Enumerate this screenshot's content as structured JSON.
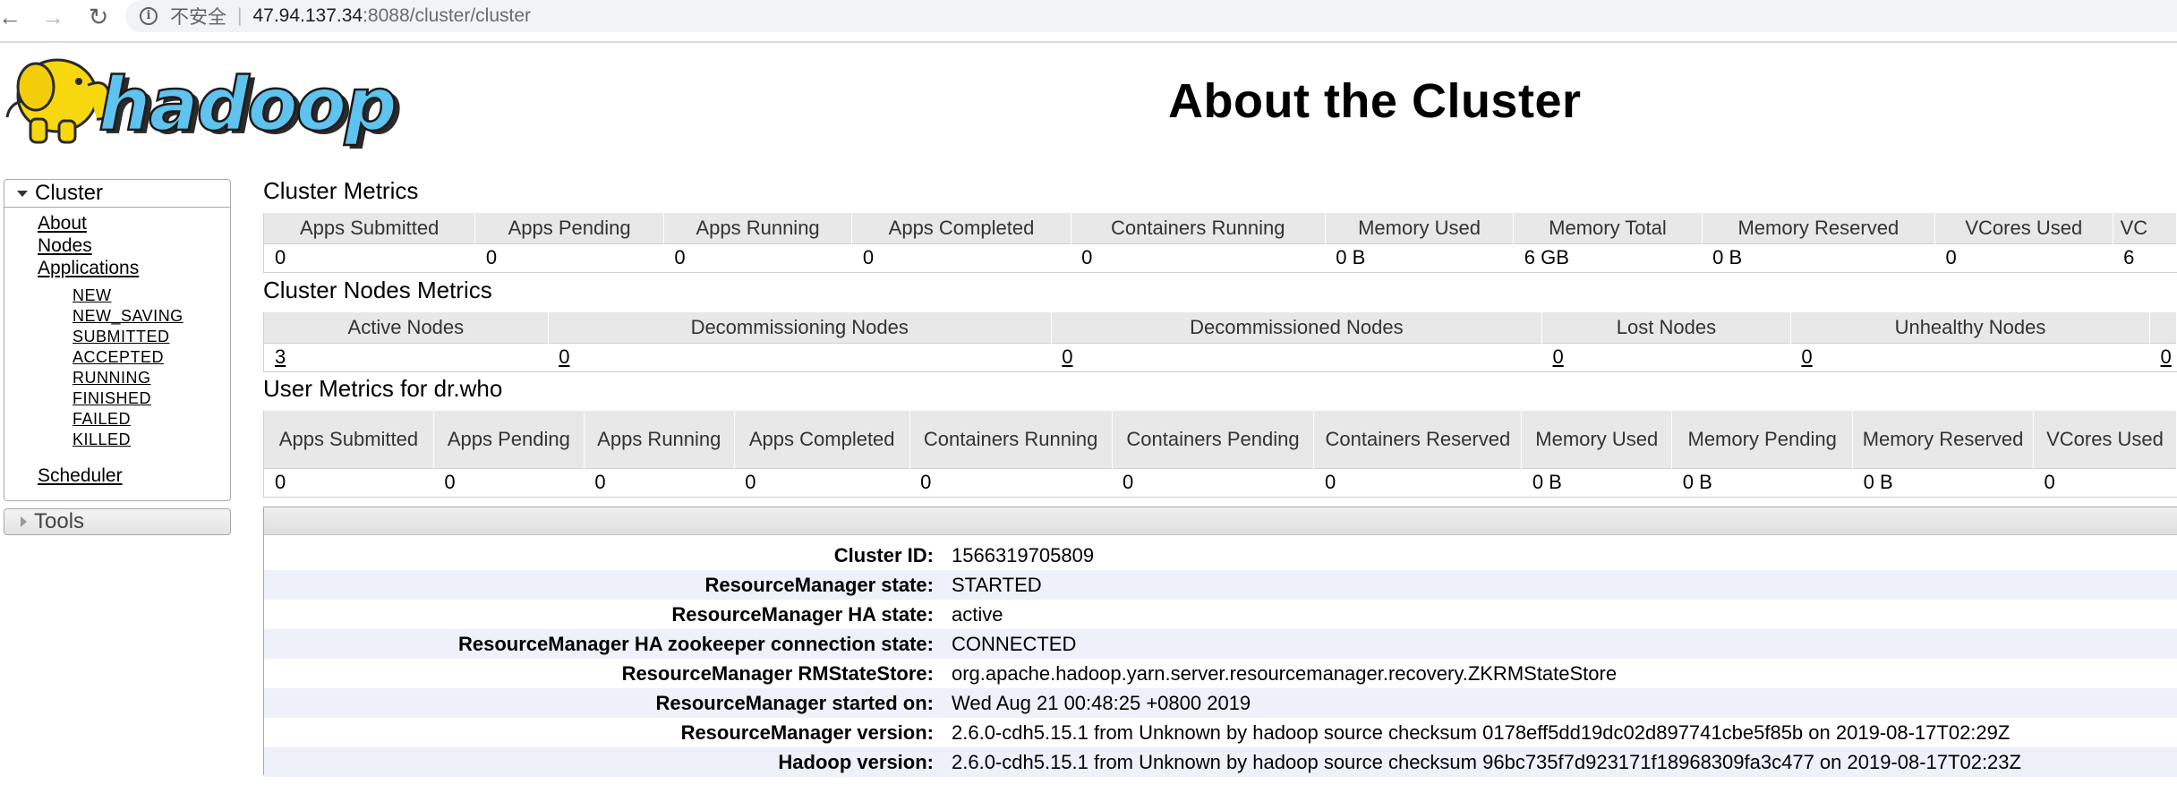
{
  "browser": {
    "security_label": "不安全",
    "url_host": "47.94.137.34",
    "url_rest": ":8088/cluster/cluster"
  },
  "header": {
    "logo_text": "hadoop",
    "title": "About the Cluster"
  },
  "sidebar": {
    "cluster_label": "Cluster",
    "links": [
      "About",
      "Nodes",
      "Applications"
    ],
    "app_states": [
      "NEW",
      "NEW_SAVING",
      "SUBMITTED",
      "ACCEPTED",
      "RUNNING",
      "FINISHED",
      "FAILED",
      "KILLED"
    ],
    "scheduler_label": "Scheduler",
    "tools_label": "Tools"
  },
  "cluster_metrics": {
    "title": "Cluster Metrics",
    "headers": [
      "Apps Submitted",
      "Apps Pending",
      "Apps Running",
      "Apps Completed",
      "Containers Running",
      "Memory Used",
      "Memory Total",
      "Memory Reserved",
      "VCores Used",
      "VC"
    ],
    "values": [
      "0",
      "0",
      "0",
      "0",
      "0",
      "0 B",
      "6 GB",
      "0 B",
      "0",
      "6"
    ]
  },
  "node_metrics": {
    "title": "Cluster Nodes Metrics",
    "headers": [
      "Active Nodes",
      "Decommissioning Nodes",
      "Decommissioned Nodes",
      "Lost Nodes",
      "Unhealthy Nodes",
      ""
    ],
    "values": [
      "3",
      "0",
      "0",
      "0",
      "0",
      "0"
    ]
  },
  "user_metrics": {
    "title": "User Metrics for dr.who",
    "headers": [
      "Apps Submitted",
      "Apps Pending",
      "Apps Running",
      "Apps Completed",
      "Containers Running",
      "Containers Pending",
      "Containers Reserved",
      "Memory Used",
      "Memory Pending",
      "Memory Reserved",
      "VCores Used"
    ],
    "values": [
      "0",
      "0",
      "0",
      "0",
      "0",
      "0",
      "0",
      "0 B",
      "0 B",
      "0 B",
      "0"
    ]
  },
  "about": {
    "rows": [
      {
        "label": "Cluster ID:",
        "value": "1566319705809"
      },
      {
        "label": "ResourceManager state:",
        "value": "STARTED"
      },
      {
        "label": "ResourceManager HA state:",
        "value": "active"
      },
      {
        "label": "ResourceManager HA zookeeper connection state:",
        "value": "CONNECTED"
      },
      {
        "label": "ResourceManager RMStateStore:",
        "value": "org.apache.hadoop.yarn.server.resourcemanager.recovery.ZKRMStateStore"
      },
      {
        "label": "ResourceManager started on:",
        "value": "Wed Aug 21 00:48:25 +0800 2019"
      },
      {
        "label": "ResourceManager version:",
        "value": "2.6.0-cdh5.15.1 from Unknown by hadoop source checksum 0178eff5dd19dc02d897741cbe5f85b on 2019-08-17T02:29Z"
      },
      {
        "label": "Hadoop version:",
        "value": "2.6.0-cdh5.15.1 from Unknown by hadoop source checksum 96bc735f7d923171f18968309fa3c477 on 2019-08-17T02:23Z"
      }
    ]
  },
  "colors": {
    "logo_yellow": "#f7d80f",
    "logo_blue": "#5ec3ee",
    "row_alt": "#eef0fa",
    "header_gray": "#e8e8e8"
  }
}
